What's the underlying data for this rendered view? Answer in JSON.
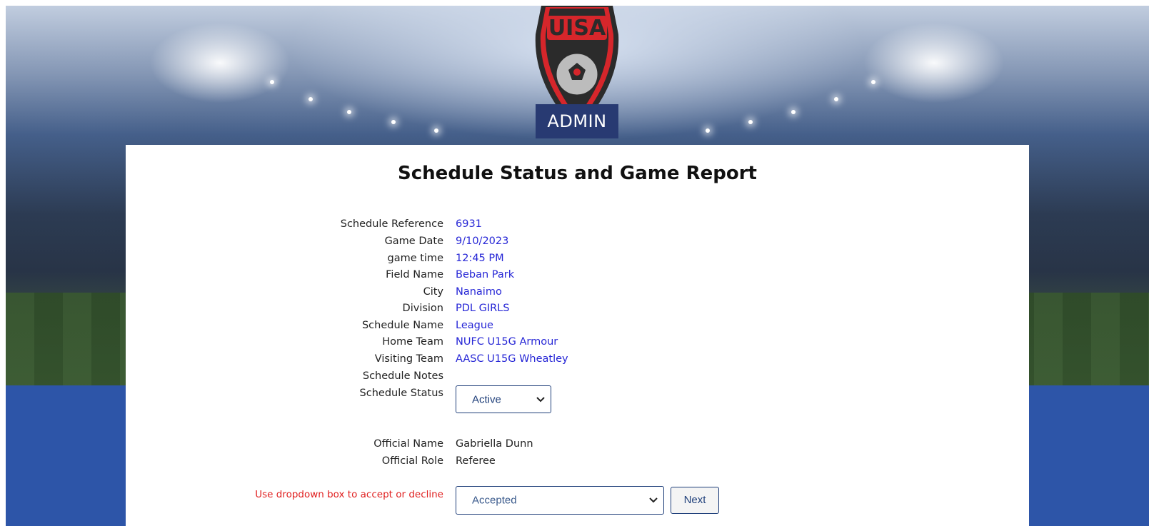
{
  "header": {
    "logo_text": "UISA",
    "badge": "ADMIN"
  },
  "page": {
    "title": "Schedule Status and Game Report"
  },
  "schedule": {
    "fields": [
      {
        "label": "Schedule Reference",
        "value": "6931"
      },
      {
        "label": "Game Date",
        "value": "9/10/2023"
      },
      {
        "label": "game time",
        "value": "12:45 PM"
      },
      {
        "label": "Field Name",
        "value": "Beban Park"
      },
      {
        "label": "City",
        "value": "Nanaimo"
      },
      {
        "label": "Division",
        "value": "PDL GIRLS"
      },
      {
        "label": "Schedule Name",
        "value": "League"
      },
      {
        "label": "Home Team",
        "value": "NUFC U15G Armour"
      },
      {
        "label": "Visiting Team",
        "value": "AASC U15G Wheatley"
      },
      {
        "label": "Schedule Notes",
        "value": ""
      }
    ],
    "status_label": "Schedule Status",
    "status_value": "Active"
  },
  "official": {
    "name_label": "Official Name",
    "name_value": "Gabriella Dunn",
    "role_label": "Official Role",
    "role_value": "Referee"
  },
  "response": {
    "hint": "Use dropdown box to accept or decline",
    "selected": "Accepted",
    "next_label": "Next"
  },
  "colors": {
    "accent_blue": "#2d55a8",
    "badge_bg": "#283a72",
    "value_text": "#2626d6",
    "hint_text": "#e02020"
  }
}
